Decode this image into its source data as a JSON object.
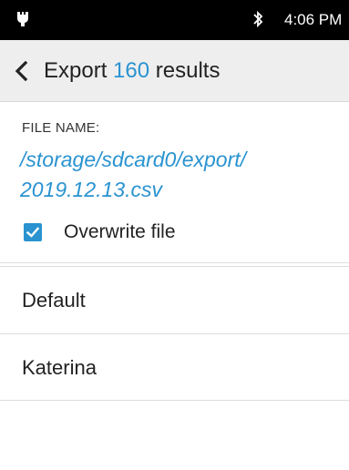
{
  "status_bar": {
    "time": "4:06 PM",
    "icons": [
      "notification-icon",
      "bluetooth-icon"
    ]
  },
  "header": {
    "title_prefix": "Export",
    "title_count": "160",
    "title_suffix": "results",
    "back_icon": "chevron-left-icon"
  },
  "file": {
    "label": "FILE NAME:",
    "path_line1": "/storage/sdcard0/export/",
    "path_line2": "2019.12.13.csv"
  },
  "overwrite": {
    "label": "Overwrite file",
    "checked": true
  },
  "list": {
    "items": [
      {
        "label": "Default"
      },
      {
        "label": "Katerina"
      }
    ]
  },
  "colors": {
    "accent": "#2a93d0",
    "status_bar": "#000000",
    "app_bar": "#eeeeee"
  }
}
